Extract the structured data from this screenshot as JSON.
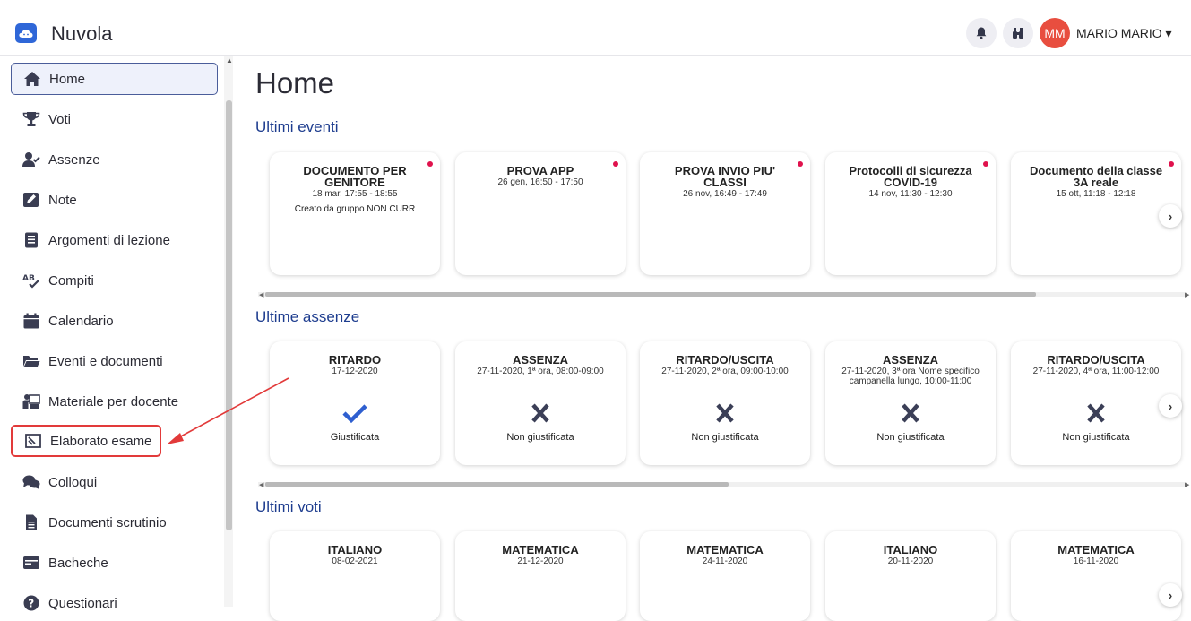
{
  "app": {
    "title": "Nuvola"
  },
  "header": {
    "icons": [
      "bell-icon",
      "binoculars-icon"
    ],
    "avatar_initials": "MM",
    "user_name": "MARIO MARIO ▾",
    "avatar_color": "#e84e3f"
  },
  "sidebar": {
    "items": [
      {
        "label": "Home",
        "icon": "home-icon"
      },
      {
        "label": "Voti",
        "icon": "trophy-icon"
      },
      {
        "label": "Assenze",
        "icon": "user-check-icon"
      },
      {
        "label": "Note",
        "icon": "note-icon"
      },
      {
        "label": "Argomenti di lezione",
        "icon": "book-icon"
      },
      {
        "label": "Compiti",
        "icon": "spellcheck-icon"
      },
      {
        "label": "Calendario",
        "icon": "calendar-icon"
      },
      {
        "label": "Eventi e documenti",
        "icon": "folder-icon"
      },
      {
        "label": "Materiale per docente",
        "icon": "teacher-icon"
      },
      {
        "label": "Elaborato esame",
        "icon": "exam-icon"
      },
      {
        "label": "Colloqui",
        "icon": "chat-icon"
      },
      {
        "label": "Documenti scrutinio",
        "icon": "document-icon"
      },
      {
        "label": "Bacheche",
        "icon": "board-icon"
      },
      {
        "label": "Questionari",
        "icon": "question-icon"
      }
    ]
  },
  "main": {
    "title": "Home",
    "events": {
      "title": "Ultimi eventi",
      "cards": [
        {
          "title": "DOCUMENTO PER GENITORE",
          "subtitle": "18 mar, 17:55 - 18:55",
          "extra": "Creato da gruppo NON CURR"
        },
        {
          "title": "PROVA APP",
          "subtitle": "26 gen, 16:50 - 17:50",
          "extra": ""
        },
        {
          "title": "PROVA INVIO PIU' CLASSI",
          "subtitle": "26 nov, 16:49 - 17:49",
          "extra": ""
        },
        {
          "title": "Protocolli di sicurezza COVID-19",
          "subtitle": "14 nov, 11:30 - 12:30",
          "extra": ""
        },
        {
          "title": "Documento della classe 3A reale",
          "subtitle": "15 ott, 11:18 - 12:18",
          "extra": ""
        }
      ]
    },
    "absences": {
      "title": "Ultime assenze",
      "cards": [
        {
          "title": "RITARDO",
          "subtitle": "17-12-2020",
          "status": "Giustificata",
          "icon": "check-icon"
        },
        {
          "title": "ASSENZA",
          "subtitle": "27-11-2020, 1ª ora, 08:00-09:00",
          "status": "Non giustificata",
          "icon": "x-icon"
        },
        {
          "title": "RITARDO/USCITA",
          "subtitle": "27-11-2020, 2ª ora, 09:00-10:00",
          "status": "Non giustificata",
          "icon": "x-icon"
        },
        {
          "title": "ASSENZA",
          "subtitle": "27-11-2020, 3ª ora Nome specifico campanella lungo, 10:00-11:00",
          "status": "Non giustificata",
          "icon": "x-icon"
        },
        {
          "title": "RITARDO/USCITA",
          "subtitle": "27-11-2020, 4ª ora, 11:00-12:00",
          "status": "Non giustificata",
          "icon": "x-icon"
        }
      ]
    },
    "grades": {
      "title": "Ultimi voti",
      "cards": [
        {
          "title": "ITALIANO",
          "subtitle": "08-02-2021"
        },
        {
          "title": "MATEMATICA",
          "subtitle": "21-12-2020"
        },
        {
          "title": "MATEMATICA",
          "subtitle": "24-11-2020"
        },
        {
          "title": "ITALIANO",
          "subtitle": "20-11-2020"
        },
        {
          "title": "MATEMATICA",
          "subtitle": "16-11-2020"
        }
      ]
    },
    "next_label": "›",
    "colors": {
      "accent": "#1e3d8f",
      "unread_dot": "#e0124d",
      "check": "#2f5fd0",
      "cross": "#3b3f57",
      "annotation": "#e23a3a"
    }
  }
}
